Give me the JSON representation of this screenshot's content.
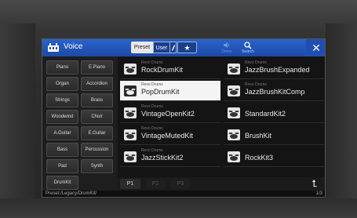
{
  "header": {
    "title": "Voice",
    "tabs": {
      "preset": "Preset",
      "user": "User",
      "favorite": "★"
    },
    "tools": {
      "demo": "Demo",
      "search": "Search"
    },
    "close": "✕"
  },
  "categories": [
    "Piano",
    "E.Piano",
    "Organ",
    "Accordion",
    "Strings",
    "Brass",
    "Woodwind",
    "Choir",
    "A.Guitar",
    "E.Guitar",
    "Bass",
    "Percussion",
    "Pad",
    "Synth",
    "DrumKit"
  ],
  "voices": [
    {
      "bank": "Revo Drums",
      "name": "RockDrumKit",
      "selected": false
    },
    {
      "bank": "Revo Drums",
      "name": "JazzBrushExpanded",
      "selected": false
    },
    {
      "bank": "Revo Drums",
      "name": "PopDrumKit",
      "selected": true
    },
    {
      "bank": "Revo Drums",
      "name": "JazzBrushKitComp",
      "selected": false
    },
    {
      "bank": "Revo Drums",
      "name": "VintageOpenKit2",
      "selected": false
    },
    {
      "bank": "",
      "name": "StandardKit2",
      "selected": false
    },
    {
      "bank": "Revo Drums",
      "name": "VintageMutedKit",
      "selected": false
    },
    {
      "bank": "",
      "name": "BrushKit",
      "selected": false
    },
    {
      "bank": "Revo Drums",
      "name": "JazzStickKit2",
      "selected": false
    },
    {
      "bank": "",
      "name": "RockKit3",
      "selected": false
    }
  ],
  "pages": [
    "P1",
    "P2",
    "P3"
  ],
  "active_page": "P1",
  "up_icon": "⮤",
  "status": {
    "path": "Preset:/Legacy/DrumKit/",
    "page": "1/3"
  }
}
